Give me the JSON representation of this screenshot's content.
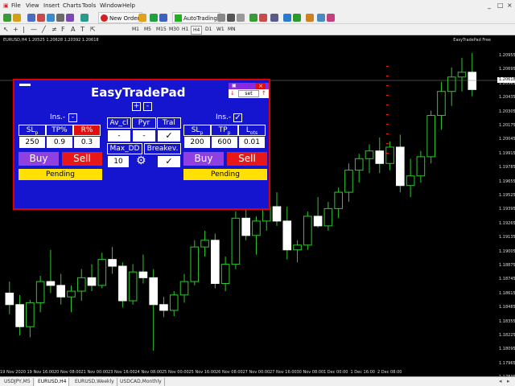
{
  "menu": [
    "File",
    "View",
    "Insert",
    "Charts",
    "Tools",
    "Window",
    "Help"
  ],
  "window_controls": [
    "_",
    "□",
    "×"
  ],
  "toolbar": {
    "new_order": "New Order",
    "autotrading": "AutoTrading"
  },
  "timeframes": [
    "M1",
    "M5",
    "M15",
    "M30",
    "H1",
    "H4",
    "D1",
    "W1",
    "MN"
  ],
  "active_timeframe": "H4",
  "chart": {
    "title": "EURUSD,H4  1.20525 1.20628 1.20392 1.20618",
    "ea_name": "EasyTradePad Free",
    "current_price": "1.20618",
    "price_labels": [
      "1.20955",
      "1.20695",
      "1.20565",
      "1.20435",
      "1.20305",
      "1.20175",
      "1.20045",
      "1.19915",
      "1.19785",
      "1.19655",
      "1.19525",
      "1.19395",
      "1.19265",
      "1.19135",
      "1.19005",
      "1.18875",
      "1.18745",
      "1.18615",
      "1.18485",
      "1.18355",
      "1.18225",
      "1.18095",
      "1.17965",
      "1.17835"
    ],
    "time_labels": [
      "19 Nov 2020",
      "19 Nov 16:00",
      "20 Nov 08:00",
      "21 Nov 00:00",
      "23 Nov 16:00",
      "24 Nov 08:00",
      "25 Nov 00:00",
      "25 Nov 16:00",
      "26 Nov 08:00",
      "27 Nov 00:00",
      "27 Nov 16:00",
      "30 Nov 08:00",
      "1 Dec 00:00",
      "1 Dec 16:00",
      "2 Dec 08:00"
    ]
  },
  "panel": {
    "title": "EasyTradePad",
    "plus": "+",
    "minus": "-",
    "mini_set": "set",
    "mini_close": "×",
    "left": {
      "ins_label": "Ins.-",
      "headers": [
        "SL",
        "TP%",
        "R%"
      ],
      "header_subs": [
        "p",
        "",
        ""
      ],
      "values": [
        "250",
        "0.9",
        "0.3"
      ],
      "buy": "Buy",
      "sell": "Sell",
      "pending": "Pending"
    },
    "middle": {
      "row1": [
        "Av_cl",
        "Pyr",
        "Tral"
      ],
      "row2": [
        "-",
        "-",
        "✓"
      ],
      "max_dd": "Max_DD",
      "breakeven": "Breakev.",
      "max_dd_value": "10",
      "breakeven_check": "✓"
    },
    "right": {
      "ins_label": "Ins.-",
      "headers": [
        "SL",
        "TP",
        "L"
      ],
      "header_subs": [
        "p",
        "p",
        "ots"
      ],
      "values": [
        "200",
        "600",
        "0.01"
      ],
      "buy": "Buy",
      "sell": "Sell",
      "pending": "Pending"
    }
  },
  "tabs": [
    "USDJPY,M5",
    "EURUSD,H4",
    "EURUSD,Weekly",
    "USDCAD,Monthly"
  ],
  "active_tab": "EURUSD,H4",
  "candles": [
    {
      "o": 1.185,
      "h": 1.1862,
      "l": 1.1828,
      "c": 1.1838
    },
    {
      "o": 1.1838,
      "h": 1.1848,
      "l": 1.1806,
      "c": 1.1815
    },
    {
      "o": 1.1815,
      "h": 1.1843,
      "l": 1.1804,
      "c": 1.184
    },
    {
      "o": 1.184,
      "h": 1.1868,
      "l": 1.183,
      "c": 1.1862
    },
    {
      "o": 1.1862,
      "h": 1.1895,
      "l": 1.185,
      "c": 1.1858
    },
    {
      "o": 1.1858,
      "h": 1.187,
      "l": 1.1838,
      "c": 1.1846
    },
    {
      "o": 1.1846,
      "h": 1.1858,
      "l": 1.183,
      "c": 1.1852
    },
    {
      "o": 1.1852,
      "h": 1.1875,
      "l": 1.1842,
      "c": 1.1866
    },
    {
      "o": 1.1866,
      "h": 1.188,
      "l": 1.1852,
      "c": 1.1858
    },
    {
      "o": 1.1858,
      "h": 1.1892,
      "l": 1.1855,
      "c": 1.1885
    },
    {
      "o": 1.1885,
      "h": 1.1898,
      "l": 1.187,
      "c": 1.1878
    },
    {
      "o": 1.1878,
      "h": 1.1882,
      "l": 1.1835,
      "c": 1.1842
    },
    {
      "o": 1.1842,
      "h": 1.188,
      "l": 1.1838,
      "c": 1.1872
    },
    {
      "o": 1.1872,
      "h": 1.189,
      "l": 1.186,
      "c": 1.1866
    },
    {
      "o": 1.1866,
      "h": 1.1875,
      "l": 1.179,
      "c": 1.1838
    },
    {
      "o": 1.1838,
      "h": 1.1846,
      "l": 1.1825,
      "c": 1.1832
    },
    {
      "o": 1.1832,
      "h": 1.1852,
      "l": 1.1826,
      "c": 1.1848
    },
    {
      "o": 1.1848,
      "h": 1.187,
      "l": 1.184,
      "c": 1.1862
    },
    {
      "o": 1.1862,
      "h": 1.1905,
      "l": 1.1858,
      "c": 1.1898
    },
    {
      "o": 1.1898,
      "h": 1.1915,
      "l": 1.1888,
      "c": 1.1905
    },
    {
      "o": 1.1905,
      "h": 1.1912,
      "l": 1.1855,
      "c": 1.186
    },
    {
      "o": 1.186,
      "h": 1.1888,
      "l": 1.1852,
      "c": 1.188
    },
    {
      "o": 1.188,
      "h": 1.1935,
      "l": 1.1875,
      "c": 1.1928
    },
    {
      "o": 1.1928,
      "h": 1.195,
      "l": 1.1905,
      "c": 1.191
    },
    {
      "o": 1.191,
      "h": 1.193,
      "l": 1.189,
      "c": 1.1925
    },
    {
      "o": 1.1925,
      "h": 1.1945,
      "l": 1.1915,
      "c": 1.194
    },
    {
      "o": 1.194,
      "h": 1.1955,
      "l": 1.192,
      "c": 1.1925
    },
    {
      "o": 1.1925,
      "h": 1.194,
      "l": 1.1885,
      "c": 1.1895
    },
    {
      "o": 1.1895,
      "h": 1.1905,
      "l": 1.1882,
      "c": 1.19
    },
    {
      "o": 1.19,
      "h": 1.1935,
      "l": 1.1895,
      "c": 1.193
    },
    {
      "o": 1.193,
      "h": 1.195,
      "l": 1.1918,
      "c": 1.192
    },
    {
      "o": 1.192,
      "h": 1.1945,
      "l": 1.1915,
      "c": 1.1938
    },
    {
      "o": 1.1938,
      "h": 1.196,
      "l": 1.1928,
      "c": 1.1955
    },
    {
      "o": 1.1955,
      "h": 1.1985,
      "l": 1.1945,
      "c": 1.1978
    },
    {
      "o": 1.1978,
      "h": 1.1995,
      "l": 1.1965,
      "c": 1.199
    },
    {
      "o": 1.199,
      "h": 1.2005,
      "l": 1.1975,
      "c": 1.1998
    },
    {
      "o": 1.1998,
      "h": 1.2012,
      "l": 1.1975,
      "c": 1.1985
    },
    {
      "o": 1.1985,
      "h": 1.2008,
      "l": 1.1978,
      "c": 1.2002
    },
    {
      "o": 1.2002,
      "h": 1.2015,
      "l": 1.1955,
      "c": 1.1962
    },
    {
      "o": 1.1962,
      "h": 1.199,
      "l": 1.195,
      "c": 1.1972
    },
    {
      "o": 1.1972,
      "h": 1.1998,
      "l": 1.1965,
      "c": 1.1992
    },
    {
      "o": 1.1992,
      "h": 1.204,
      "l": 1.1985,
      "c": 1.2035
    },
    {
      "o": 1.2035,
      "h": 1.207,
      "l": 1.202,
      "c": 1.206
    },
    {
      "o": 1.206,
      "h": 1.2085,
      "l": 1.2045,
      "c": 1.2075
    },
    {
      "o": 1.2075,
      "h": 1.2095,
      "l": 1.206,
      "c": 1.208
    },
    {
      "o": 1.208,
      "h": 1.21,
      "l": 1.2055,
      "c": 1.2062
    }
  ]
}
